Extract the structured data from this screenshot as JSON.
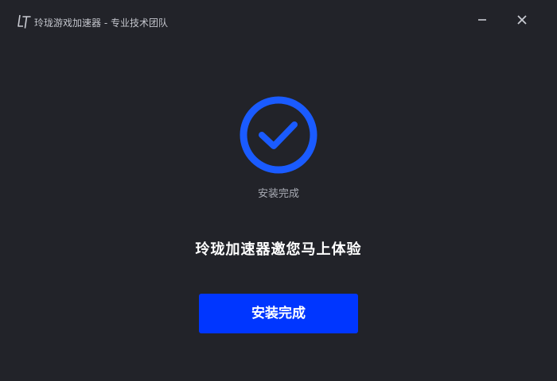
{
  "window": {
    "title": "玲珑游戏加速器 - 专业技术团队"
  },
  "icons": {
    "logo": "lingling-logo-icon",
    "minimize": "minimize-icon",
    "close": "close-icon",
    "status": "check-circle-icon"
  },
  "main": {
    "status_label": "安装完成",
    "headline": "玲珑加速器邀您马上体验",
    "finish_button_label": "安装完成"
  },
  "colors": {
    "background": "#222329",
    "accent": "#0036ff",
    "check": "#1a5bff"
  }
}
